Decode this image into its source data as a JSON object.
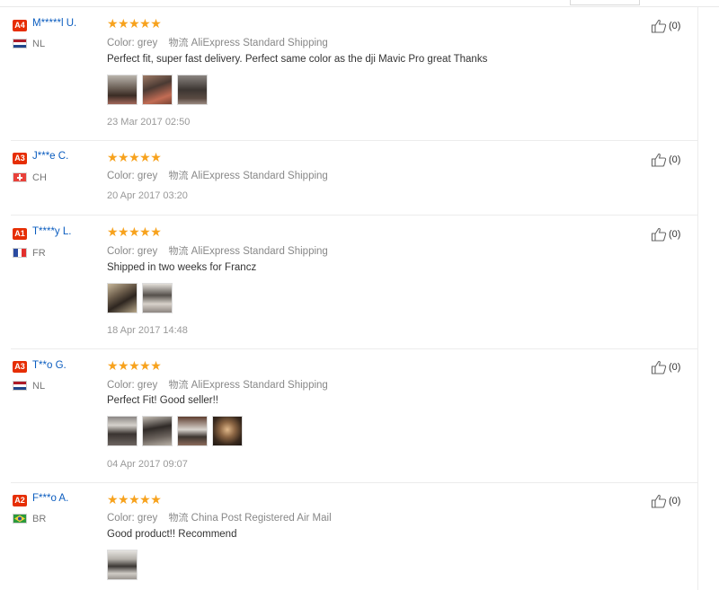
{
  "field_labels": {
    "color": "Color:",
    "shipping_icon_text": "物流"
  },
  "reviews": [
    {
      "level": "A4",
      "name": "M*****l U.",
      "country": "NL",
      "flag": "nl",
      "stars": "★★★★★",
      "color": "grey",
      "shipping": "AliExpress Standard Shipping",
      "comment": "Perfect fit, super fast delivery. Perfect same color as the dji Mavic Pro great Thanks",
      "photo_count": 3,
      "date": "23 Mar 2017 02:50",
      "helpful": "(0)"
    },
    {
      "level": "A3",
      "name": "J***e C.",
      "country": "CH",
      "flag": "ch",
      "stars": "★★★★★",
      "color": "grey",
      "shipping": "AliExpress Standard Shipping",
      "comment": "",
      "photo_count": 0,
      "date": "20 Apr 2017 03:20",
      "helpful": "(0)"
    },
    {
      "level": "A1",
      "name": "T****y L.",
      "country": "FR",
      "flag": "fr",
      "stars": "★★★★★",
      "color": "grey",
      "shipping": "AliExpress Standard Shipping",
      "comment": "Shipped in two weeks for Francz",
      "photo_count": 2,
      "date": "18 Apr 2017 14:48",
      "helpful": "(0)"
    },
    {
      "level": "A3",
      "name": "T**o G.",
      "country": "NL",
      "flag": "nl",
      "stars": "★★★★★",
      "color": "grey",
      "shipping": "AliExpress Standard Shipping",
      "comment": "Perfect Fit! Good seller!!",
      "photo_count": 4,
      "date": "04 Apr 2017 09:07",
      "helpful": "(0)"
    },
    {
      "level": "A2",
      "name": "F***o A.",
      "country": "BR",
      "flag": "br",
      "stars": "★★★★★",
      "color": "grey",
      "shipping": "China Post Registered Air Mail",
      "comment": "Good product!! Recommend",
      "photo_count": 1,
      "date": "",
      "helpful": "(0)"
    }
  ],
  "colors": {
    "accent_red": "#e62e04",
    "star": "#f7a21d",
    "username": "#0a5cbf"
  }
}
